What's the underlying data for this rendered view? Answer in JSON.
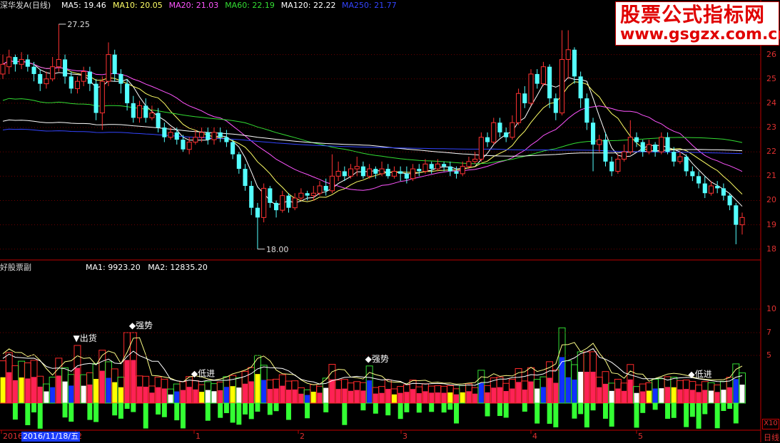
{
  "chart_data": [
    {
      "type": "candlestick",
      "title": "深华发A(日线)",
      "ma_legend": [
        {
          "name": "MA5",
          "value": "19.46",
          "color": "#ffffff"
        },
        {
          "name": "MA10",
          "value": "20.05",
          "color": "#ffff66"
        },
        {
          "name": "MA20",
          "value": "21.03",
          "color": "#ff55ff"
        },
        {
          "name": "MA60",
          "value": "22.19",
          "color": "#33dd33"
        },
        {
          "name": "MA120",
          "value": "22.22",
          "color": "#ffffff"
        },
        {
          "name": "MA250",
          "value": "21.77",
          "color": "#3344ff"
        }
      ],
      "y_ticks": [
        "26",
        "25",
        "24",
        "23",
        "22",
        "21",
        "20",
        "19",
        "18"
      ],
      "ylim": [
        17.7,
        27.6
      ],
      "annotations": [
        {
          "text": "27.25",
          "price": 27.25
        },
        {
          "text": "18.00",
          "price": 18.0
        }
      ],
      "candles": [
        [
          25.2,
          25.6,
          25.0,
          26.0
        ],
        [
          25.5,
          25.9,
          25.2,
          26.2
        ],
        [
          25.9,
          25.6,
          25.3,
          26.0
        ],
        [
          25.6,
          25.8,
          25.4,
          26.1
        ],
        [
          25.8,
          25.5,
          25.3,
          26.0
        ],
        [
          25.5,
          25.2,
          24.9,
          25.7
        ],
        [
          25.2,
          24.8,
          24.5,
          25.4
        ],
        [
          24.8,
          25.0,
          24.6,
          25.3
        ],
        [
          25.0,
          25.5,
          24.9,
          25.9
        ],
        [
          25.5,
          25.8,
          25.3,
          27.25
        ],
        [
          25.8,
          25.1,
          24.8,
          26.0
        ],
        [
          25.1,
          24.6,
          24.4,
          25.3
        ],
        [
          24.6,
          24.9,
          24.4,
          25.1
        ],
        [
          24.9,
          25.3,
          24.7,
          25.5
        ],
        [
          25.3,
          24.8,
          24.5,
          25.5
        ],
        [
          24.8,
          23.6,
          23.3,
          25.0
        ],
        [
          23.6,
          24.9,
          22.9,
          25.1
        ],
        [
          24.9,
          26.0,
          24.7,
          26.5
        ],
        [
          26.0,
          25.2,
          24.9,
          26.2
        ],
        [
          25.2,
          24.8,
          24.4,
          25.4
        ],
        [
          24.8,
          24.0,
          23.7,
          25.0
        ],
        [
          24.0,
          23.4,
          23.2,
          24.3
        ],
        [
          23.4,
          23.9,
          23.2,
          24.1
        ],
        [
          23.9,
          23.4,
          23.2,
          24.2
        ],
        [
          23.4,
          23.6,
          23.3,
          23.9
        ],
        [
          23.6,
          23.0,
          22.8,
          23.8
        ],
        [
          23.0,
          22.6,
          22.4,
          23.2
        ],
        [
          22.6,
          22.8,
          22.5,
          23.0
        ],
        [
          22.8,
          22.5,
          22.3,
          23.0
        ],
        [
          22.5,
          22.1,
          22.0,
          22.7
        ],
        [
          22.1,
          22.4,
          21.9,
          22.6
        ],
        [
          22.4,
          22.6,
          22.3,
          22.9
        ],
        [
          22.6,
          22.8,
          22.4,
          23.0
        ],
        [
          22.8,
          22.5,
          22.3,
          23.0
        ],
        [
          22.5,
          22.8,
          22.3,
          23.0
        ],
        [
          22.8,
          22.6,
          22.4,
          23.0
        ],
        [
          22.6,
          22.4,
          22.2,
          22.9
        ],
        [
          22.4,
          21.9,
          21.7,
          22.5
        ],
        [
          21.9,
          21.3,
          21.1,
          22.0
        ],
        [
          21.3,
          20.6,
          20.4,
          21.5
        ],
        [
          20.6,
          19.7,
          19.4,
          20.8
        ],
        [
          19.7,
          19.3,
          18.0,
          19.9
        ],
        [
          19.3,
          20.5,
          19.1,
          20.7
        ],
        [
          20.5,
          19.9,
          19.7,
          20.6
        ],
        [
          19.9,
          19.6,
          19.3,
          20.0
        ],
        [
          19.6,
          20.2,
          19.5,
          20.4
        ],
        [
          20.2,
          19.7,
          19.5,
          20.3
        ],
        [
          19.7,
          20.1,
          19.6,
          20.3
        ],
        [
          20.1,
          20.3,
          20.0,
          20.5
        ],
        [
          20.3,
          20.2,
          20.0,
          20.4
        ],
        [
          20.2,
          20.3,
          20.0,
          20.6
        ],
        [
          20.3,
          20.6,
          20.2,
          20.8
        ],
        [
          20.6,
          20.4,
          20.2,
          20.9
        ],
        [
          20.4,
          21.0,
          20.3,
          21.9
        ],
        [
          21.0,
          21.2,
          20.8,
          21.6
        ],
        [
          21.2,
          21.0,
          20.8,
          21.4
        ],
        [
          21.0,
          21.3,
          20.9,
          21.5
        ],
        [
          21.3,
          21.4,
          21.0,
          21.8
        ],
        [
          21.4,
          21.0,
          20.9,
          21.6
        ],
        [
          21.0,
          21.3,
          20.9,
          21.5
        ],
        [
          21.3,
          21.1,
          20.9,
          21.4
        ],
        [
          21.1,
          21.3,
          21.0,
          21.6
        ],
        [
          21.3,
          21.0,
          20.9,
          21.5
        ],
        [
          21.0,
          21.2,
          20.9,
          21.4
        ],
        [
          21.2,
          21.1,
          20.8,
          21.4
        ],
        [
          21.1,
          20.9,
          20.7,
          21.4
        ],
        [
          20.9,
          21.3,
          20.8,
          21.5
        ],
        [
          21.3,
          21.2,
          21.0,
          21.5
        ],
        [
          21.2,
          21.5,
          21.1,
          21.7
        ],
        [
          21.5,
          21.3,
          21.1,
          21.6
        ],
        [
          21.3,
          21.5,
          21.2,
          21.7
        ],
        [
          21.5,
          21.4,
          21.2,
          21.6
        ],
        [
          21.4,
          21.2,
          21.0,
          21.6
        ],
        [
          21.2,
          21.1,
          20.9,
          21.4
        ],
        [
          21.1,
          21.4,
          21.0,
          21.6
        ],
        [
          21.4,
          21.6,
          21.3,
          21.8
        ],
        [
          21.6,
          21.7,
          21.5,
          22.0
        ],
        [
          21.7,
          22.6,
          21.6,
          22.8
        ],
        [
          22.6,
          22.4,
          22.2,
          22.8
        ],
        [
          22.4,
          23.2,
          22.3,
          23.4
        ],
        [
          23.2,
          22.8,
          22.6,
          23.4
        ],
        [
          22.8,
          22.6,
          22.4,
          23.0
        ],
        [
          22.6,
          23.2,
          22.5,
          23.5
        ],
        [
          23.2,
          24.4,
          23.1,
          24.6
        ],
        [
          24.4,
          24.0,
          23.8,
          24.7
        ],
        [
          24.0,
          25.2,
          23.9,
          25.4
        ],
        [
          25.2,
          24.8,
          24.6,
          25.4
        ],
        [
          24.8,
          25.5,
          24.7,
          25.7
        ],
        [
          25.5,
          24.2,
          23.8,
          25.6
        ],
        [
          24.2,
          23.6,
          23.3,
          24.4
        ],
        [
          23.6,
          25.8,
          23.5,
          27.0
        ],
        [
          25.8,
          26.2,
          25.0,
          27.0
        ],
        [
          26.2,
          25.1,
          24.8,
          26.3
        ],
        [
          25.1,
          24.2,
          23.8,
          25.3
        ],
        [
          24.2,
          23.2,
          22.9,
          24.4
        ],
        [
          23.2,
          22.3,
          21.2,
          23.4
        ],
        [
          22.3,
          22.5,
          22.0,
          22.7
        ],
        [
          22.5,
          21.6,
          21.4,
          22.8
        ],
        [
          21.6,
          21.2,
          21.0,
          21.8
        ],
        [
          21.2,
          21.7,
          21.1,
          21.9
        ],
        [
          21.7,
          22.0,
          21.6,
          22.3
        ],
        [
          22.0,
          22.6,
          21.9,
          23.3
        ],
        [
          22.6,
          22.4,
          22.2,
          22.8
        ],
        [
          22.4,
          22.0,
          21.8,
          22.5
        ],
        [
          22.0,
          22.3,
          21.9,
          22.5
        ],
        [
          22.3,
          22.0,
          21.8,
          22.4
        ],
        [
          22.0,
          22.6,
          21.9,
          22.8
        ],
        [
          22.6,
          22.0,
          21.9,
          22.8
        ],
        [
          22.0,
          21.6,
          21.4,
          22.2
        ],
        [
          21.6,
          21.8,
          21.5,
          22.0
        ],
        [
          21.8,
          21.2,
          21.0,
          21.9
        ],
        [
          21.2,
          21.0,
          20.8,
          21.4
        ],
        [
          21.0,
          20.7,
          20.5,
          21.2
        ],
        [
          20.7,
          20.3,
          20.1,
          21.0
        ],
        [
          20.3,
          20.6,
          20.2,
          20.8
        ],
        [
          20.6,
          20.5,
          20.3,
          20.8
        ],
        [
          20.5,
          20.2,
          20.0,
          20.7
        ],
        [
          20.2,
          19.8,
          19.6,
          20.3
        ],
        [
          19.8,
          19.0,
          18.2,
          19.9
        ],
        [
          19.0,
          19.3,
          18.6,
          19.5
        ]
      ]
    },
    {
      "type": "bar",
      "title": "好股票副",
      "ma_legend": [
        {
          "name": "MA1",
          "value": "9923.20",
          "color": "#ffffff"
        },
        {
          "name": "MA2",
          "value": "12835.20",
          "color": "#ffffff"
        }
      ],
      "y_ticks": [
        "10",
        "7",
        "5"
      ],
      "annotations": [
        {
          "text": "▼出货",
          "index": 12
        },
        {
          "text": "◆强势",
          "index": 21
        },
        {
          "text": "◆低进",
          "index": 31
        },
        {
          "text": "◆强势",
          "index": 59
        },
        {
          "text": "◆低进",
          "index": 111
        }
      ]
    }
  ],
  "x_ticks": [
    "2016",
    "2",
    "1",
    "2",
    "3",
    "4",
    "5"
  ],
  "cursor_date": "2016/11/18/五",
  "corner_scale": "X10",
  "corner_label": "日线",
  "watermark": {
    "title": "股票公式指标网",
    "url": "www.gsgzx.com.cn"
  }
}
